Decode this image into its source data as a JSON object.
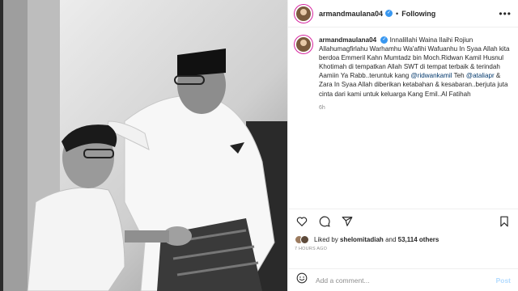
{
  "header": {
    "username": "armandmaulana04",
    "separator": "•",
    "follow_label": "Following",
    "more_icon": "more-horizontal-icon"
  },
  "caption": {
    "username": "armandmaulana04",
    "text_1": "Innalillahi Waina Ilaihi Rojiun Allahumagfirlahu Warhamhu Wa'afihi Wafuanhu In Syaa Allah kita berdoa Emmeril Kahn Mumtadz bin Moch.Ridwan Kamil Husnul Khotimah di tempatkan Allah SWT di tempat terbaik & terindah Aamiin Ya Rabb..teruntuk kang",
    "mention_1": "@ridwankamil",
    "text_2": "Teh",
    "mention_2": "@ataliapr",
    "text_3": "& Zara In Syaa Allah diberikan ketabahan & kesabaran..berjuta juta cinta dari kami untuk keluarga Kang Emil..Al Fatihah",
    "age": "6h"
  },
  "likes": {
    "prefix": "Liked by",
    "user": "shelomitadiah",
    "and": "and",
    "count": "53,114 others"
  },
  "timestamp": "7 HOURS AGO",
  "comment": {
    "placeholder": "Add a comment...",
    "post_label": "Post"
  },
  "colors": {
    "accent": "#3897f0",
    "link": "#00376b",
    "post_disabled": "#b3dbff"
  }
}
